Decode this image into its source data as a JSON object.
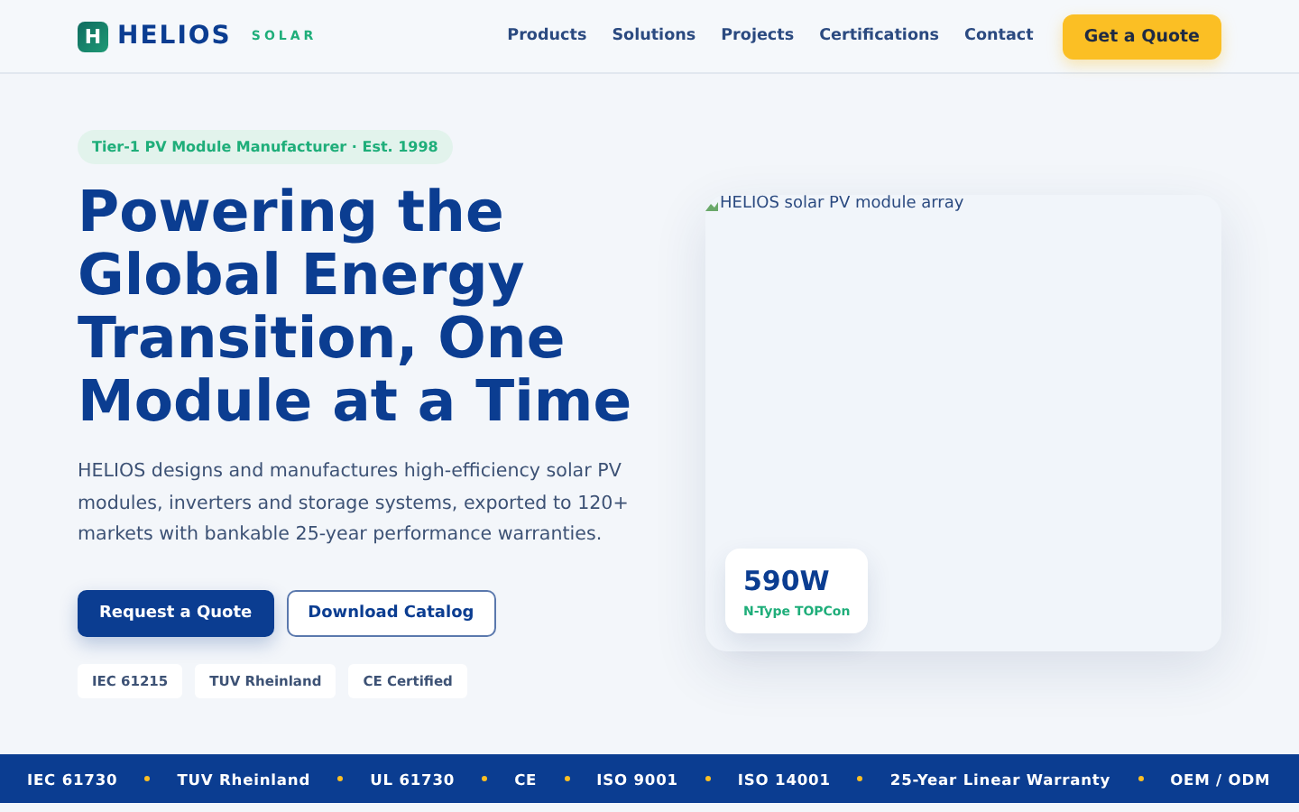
{
  "header": {
    "logo_mark": "H",
    "brand": "HELIOS",
    "brand_sub": "SOLAR",
    "nav": [
      {
        "label": "Products"
      },
      {
        "label": "Solutions"
      },
      {
        "label": "Projects"
      },
      {
        "label": "Certifications"
      },
      {
        "label": "Contact"
      }
    ],
    "cta": "Get a Quote"
  },
  "hero": {
    "badge": "Tier-1 PV Module Manufacturer · Est. 1998",
    "title": "Powering the Global Energy Transition, One Module at a Time",
    "description": "HELIOS designs and manufactures high-efficiency solar PV modules, inverters and storage systems, exported to 120+ markets with bankable 25-year performance warranties.",
    "buttons": [
      {
        "label": "Request a Quote",
        "kind": "primary"
      },
      {
        "label": "Download Catalog",
        "kind": "outline"
      }
    ],
    "certifications": [
      "IEC 61215",
      "TUV Rheinland",
      "CE Certified"
    ],
    "image": {
      "alt": "HELIOS solar PV module array",
      "stat_value": "590W",
      "stat_label": "N-Type TOPCon"
    }
  },
  "ticker": [
    "IEC 61730",
    "TUV Rheinland",
    "UL 61730",
    "CE",
    "ISO 9001",
    "ISO 14001",
    "25-Year Linear Warranty",
    "OEM / ODM"
  ]
}
